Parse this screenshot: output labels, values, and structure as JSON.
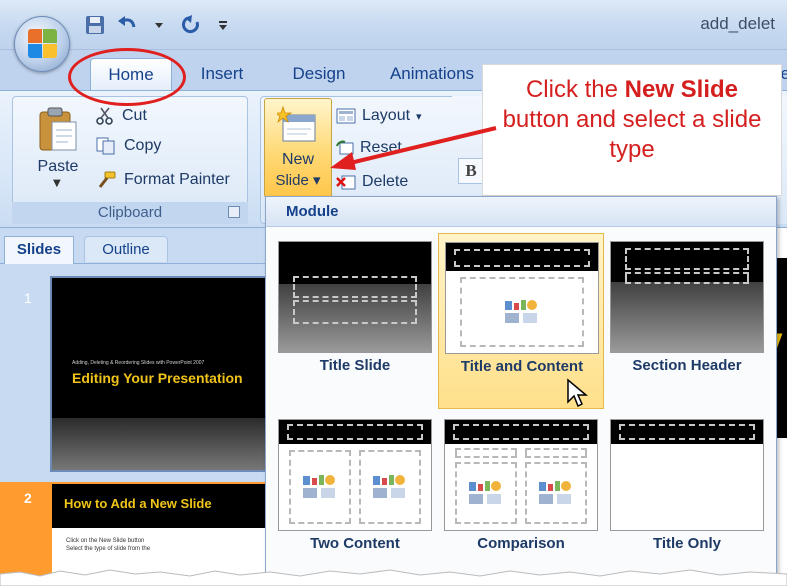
{
  "app": {
    "title": "add_delet",
    "tabs": [
      "Home",
      "Insert",
      "Design",
      "Animations",
      "Vie"
    ]
  },
  "ribbon": {
    "clipboard": {
      "group_label": "Clipboard",
      "paste": "Paste",
      "cut": "Cut",
      "copy": "Copy",
      "format_painter": "Format Painter"
    },
    "slides": {
      "new_slide_line1": "New",
      "new_slide_line2": "Slide",
      "layout": "Layout",
      "reset": "Reset",
      "delete": "Delete"
    },
    "font_bold": "B"
  },
  "callout": {
    "prefix": "Click the ",
    "bold": "New Slide",
    "suffix": "button and select a slide type"
  },
  "left_pane": {
    "tabs": [
      "Slides",
      "Outline"
    ],
    "slide1": {
      "number": "1",
      "subtitle": "Adding, Deleting & Reordering Slides with PowerPoint 2007",
      "title": "Editing Your Presentation"
    },
    "slide2": {
      "number": "2",
      "title": "How to Add a New Slide",
      "bullet1": "Click on the New Slide button",
      "bullet2": "Select the type of slide from the"
    }
  },
  "gallery": {
    "header": "Module",
    "layouts": [
      {
        "name": "Title Slide"
      },
      {
        "name": "Title and Content",
        "selected": true
      },
      {
        "name": "Section Header"
      },
      {
        "name": "Two Content"
      },
      {
        "name": "Comparison"
      },
      {
        "name": "Title Only"
      }
    ]
  },
  "main_preview": {
    "letter_top": "V",
    "letters_bottom": "li"
  },
  "colors": {
    "annotation_red": "#d51f1f",
    "ribbon_blue": "#15428b",
    "selected_gold": "#ffe08a",
    "slide_title_yellow": "#f0c419"
  }
}
